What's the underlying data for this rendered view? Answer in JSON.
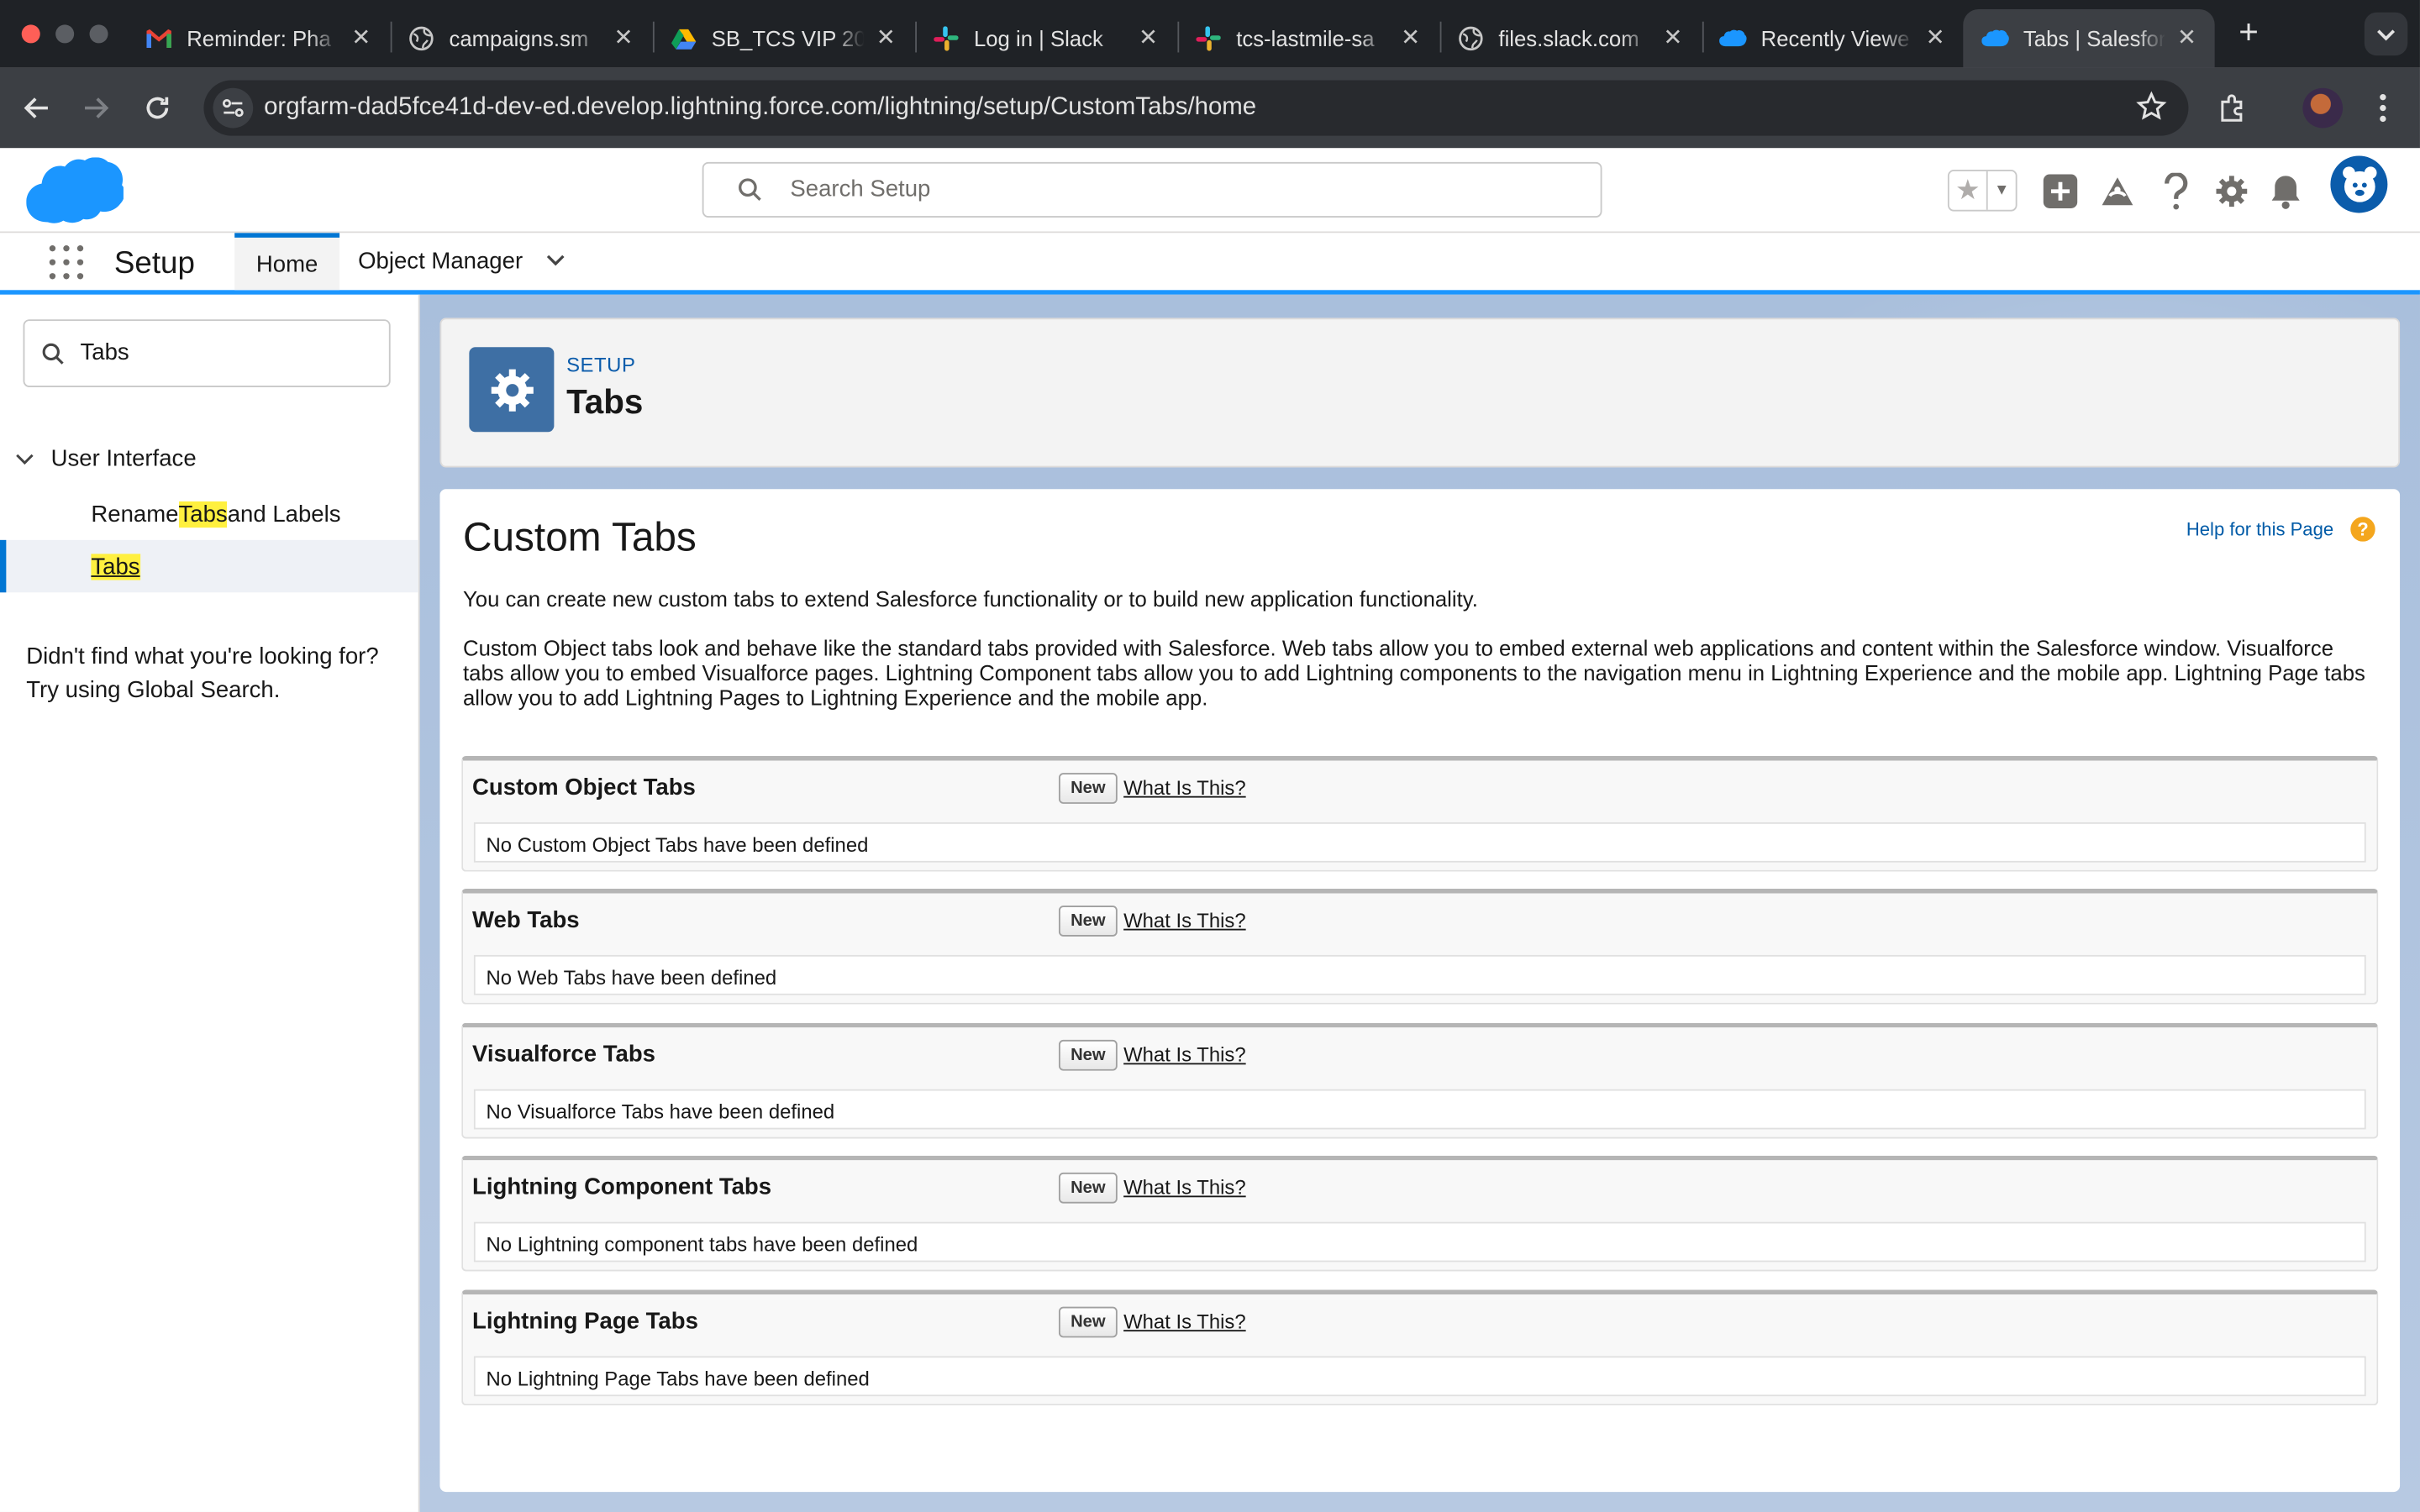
{
  "browser": {
    "tabs": [
      {
        "title": "Reminder: Pha",
        "icon": "gmail-icon",
        "active": false
      },
      {
        "title": "campaigns.sm",
        "icon": "globe-icon",
        "active": false
      },
      {
        "title": "SB_TCS VIP 20",
        "icon": "drive-icon",
        "active": false
      },
      {
        "title": "Log in | Slack",
        "icon": "slack-icon",
        "active": false
      },
      {
        "title": "tcs-lastmile-sa",
        "icon": "slack-icon",
        "active": false
      },
      {
        "title": "files.slack.com",
        "icon": "globe-icon",
        "active": false
      },
      {
        "title": "Recently Viewe",
        "icon": "salesforce-icon",
        "active": false
      },
      {
        "title": "Tabs | Salesfor",
        "icon": "salesforce-icon",
        "active": true
      }
    ],
    "url": "orgfarm-dad5fce41d-dev-ed.develop.lightning.force.com/lightning/setup/CustomTabs/home"
  },
  "header": {
    "search_placeholder": "Search Setup"
  },
  "context_bar": {
    "app_name": "Setup",
    "nav_tabs": [
      {
        "label": "Home",
        "active": true
      },
      {
        "label": "Object Manager",
        "active": false
      }
    ]
  },
  "sidebar": {
    "quick_find_value": "Tabs",
    "group_label": "User Interface",
    "items": [
      {
        "label_prefix": "Rename ",
        "label_match": "Tabs",
        "label_suffix": " and Labels",
        "selected": false
      },
      {
        "label_match": "Tabs",
        "selected": true
      }
    ],
    "not_found_line1": "Didn't find what you're looking for?",
    "not_found_line2": "Try using Global Search."
  },
  "page_header": {
    "eyebrow": "SETUP",
    "title": "Tabs"
  },
  "content": {
    "title": "Custom Tabs",
    "help_link": "Help for this Page",
    "intro": "You can create new custom tabs to extend Salesforce functionality or to build new application functionality.",
    "description": "Custom Object tabs look and behave like the standard tabs provided with Salesforce. Web tabs allow you to embed external web applications and content within the Salesforce window. Visualforce tabs allow you to embed Visualforce pages. Lightning Component tabs allow you to add Lightning components to the navigation menu in Lightning Experience and the mobile app. Lightning Page tabs allow you to add Lightning Pages to Lightning Experience and the mobile app.",
    "new_label": "New",
    "what_is_label": "What Is This?",
    "sections": [
      {
        "title": "Custom Object Tabs",
        "empty": "No Custom Object Tabs have been defined"
      },
      {
        "title": "Web Tabs",
        "empty": "No Web Tabs have been defined"
      },
      {
        "title": "Visualforce Tabs",
        "empty": "No Visualforce Tabs have been defined"
      },
      {
        "title": "Lightning Component Tabs",
        "empty": "No Lightning component tabs have been defined"
      },
      {
        "title": "Lightning Page Tabs",
        "empty": "No Lightning Page Tabs have been defined"
      }
    ]
  },
  "colors": {
    "salesforce_blue": "#0176d3",
    "setup_icon_bg": "#3e6fa4",
    "highlight": "#fff03f",
    "help_orange": "#f4a61d"
  }
}
